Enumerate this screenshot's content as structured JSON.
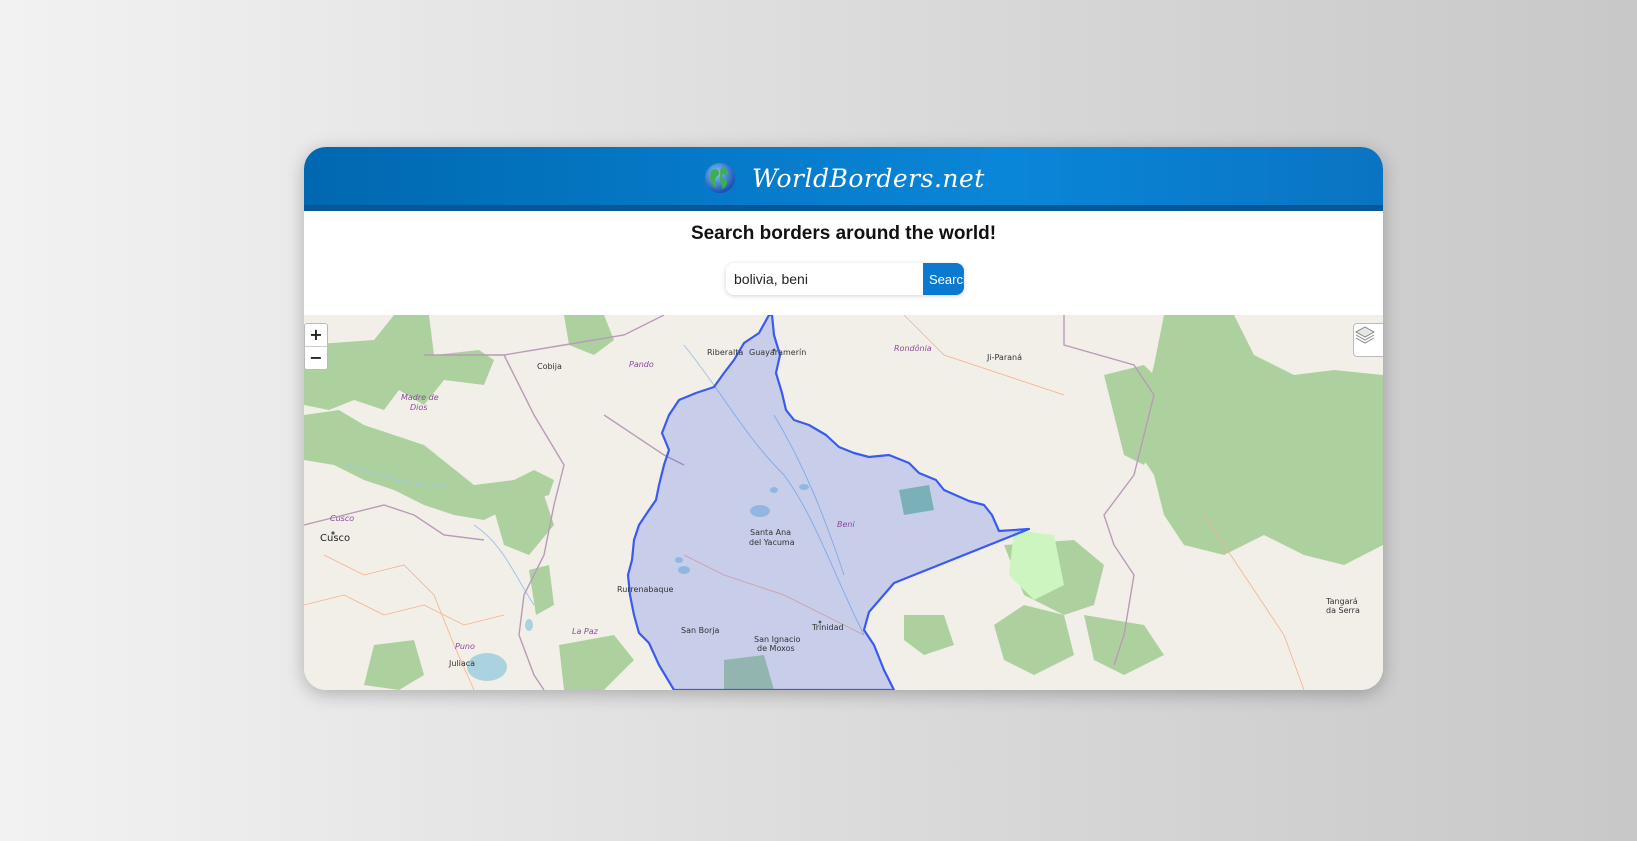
{
  "header": {
    "brand_name": "WorldBorders.net",
    "logo_icon": "globe-icon"
  },
  "tagline": "Search borders around the world!",
  "search": {
    "value": "bolivia, beni",
    "button_label": "Search"
  },
  "map": {
    "zoom_in_label": "+",
    "zoom_out_label": "−",
    "layers_icon": "layers-icon",
    "highlight_color": "#3355ee",
    "place_labels": [
      {
        "id": "cobija",
        "text": "Cobija"
      },
      {
        "id": "pando",
        "text": "Pando"
      },
      {
        "id": "riberalta",
        "text": "Riberalta"
      },
      {
        "id": "guayaramerin",
        "text": "Guayaramerín"
      },
      {
        "id": "rondonia",
        "text": "Rondônia"
      },
      {
        "id": "ji-parana",
        "text": "Ji-Paraná"
      },
      {
        "id": "madre-de-dios-1",
        "text": "Madre de"
      },
      {
        "id": "madre-de-dios-2",
        "text": "Dios"
      },
      {
        "id": "cusco-region",
        "text": "Cusco"
      },
      {
        "id": "cusco-city",
        "text": "Cusco"
      },
      {
        "id": "santa-ana-1",
        "text": "Santa Ana"
      },
      {
        "id": "santa-ana-2",
        "text": "del Yacuma"
      },
      {
        "id": "beni",
        "text": "Beni"
      },
      {
        "id": "rurrenabaque",
        "text": "Rurrenabaque"
      },
      {
        "id": "san-borja",
        "text": "San Borja"
      },
      {
        "id": "la-paz",
        "text": "La Paz"
      },
      {
        "id": "trinidad",
        "text": "Trinidad"
      },
      {
        "id": "san-ignacio-1",
        "text": "San Ignacio"
      },
      {
        "id": "san-ignacio-2",
        "text": "de Moxos"
      },
      {
        "id": "puno",
        "text": "Puno"
      },
      {
        "id": "juliaca",
        "text": "Juliaca"
      },
      {
        "id": "tangara-1",
        "text": "Tangará"
      },
      {
        "id": "tangara-2",
        "text": "da Serra"
      }
    ]
  }
}
